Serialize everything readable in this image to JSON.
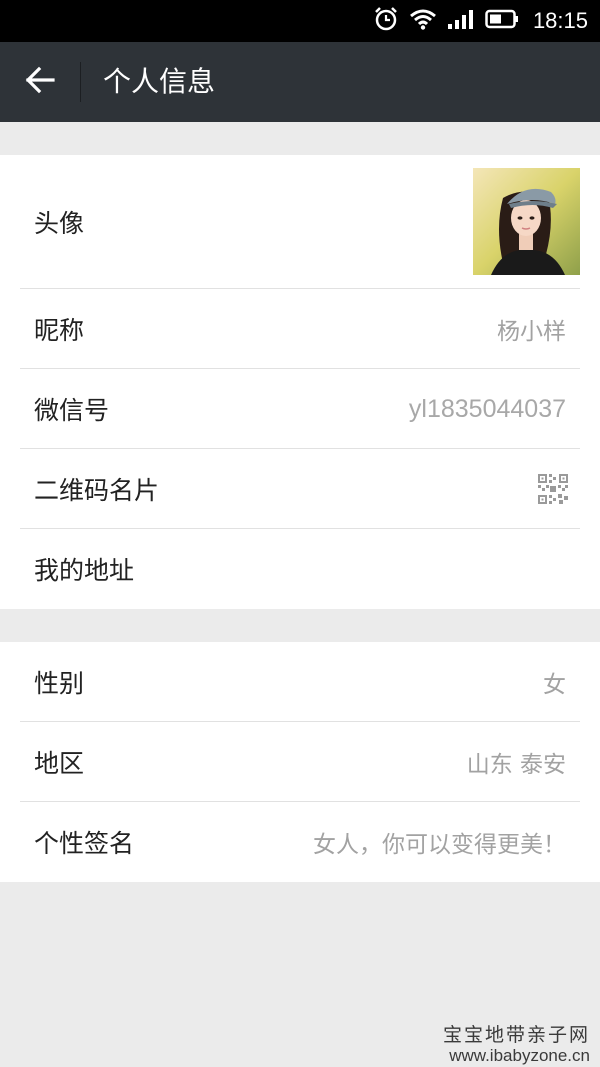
{
  "status_bar": {
    "time": "18:15",
    "icons": [
      "alarm-icon",
      "wifi-icon",
      "signal-icon",
      "battery-icon"
    ]
  },
  "app_bar": {
    "back_icon": "arrow-left-icon",
    "title": "个人信息"
  },
  "profile": {
    "avatar_label": "头像",
    "nickname": {
      "label": "昵称",
      "value": "杨小样"
    },
    "wechat_id": {
      "label": "微信号",
      "value": "yl1835044037"
    },
    "qr_card": {
      "label": "二维码名片",
      "icon": "qr-code-icon"
    },
    "address": {
      "label": "我的地址"
    }
  },
  "details": {
    "gender": {
      "label": "性别",
      "value": "女"
    },
    "region": {
      "label": "地区",
      "value": "山东 泰安"
    },
    "signature": {
      "label": "个性签名",
      "value": "女人，你可以变得更美！"
    }
  },
  "watermark": {
    "line1": "宝宝地带亲子网",
    "line2": "www.ibabyzone.cn"
  },
  "colors": {
    "app_bar_bg": "#2e3338",
    "page_bg": "#ebebeb",
    "value_text": "#a2a2a2"
  }
}
